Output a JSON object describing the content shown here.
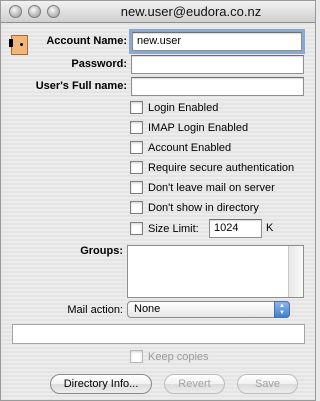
{
  "window": {
    "title": "new.user@eudora.co.nz"
  },
  "account": {
    "name_label": "Account Name:",
    "name_value": "new.user",
    "password_label": "Password:",
    "password_value": "",
    "fullname_label": "User's Full name:",
    "fullname_value": ""
  },
  "options": [
    {
      "label": "Login Enabled",
      "checked": false
    },
    {
      "label": "IMAP Login Enabled",
      "checked": false
    },
    {
      "label": "Account Enabled",
      "checked": false
    },
    {
      "label": "Require secure authentication",
      "checked": false
    },
    {
      "label": "Don't leave mail on server",
      "checked": false
    },
    {
      "label": "Don't show in directory",
      "checked": false
    }
  ],
  "size_limit": {
    "label": "Size Limit:",
    "value": "1024",
    "unit": "K"
  },
  "groups": {
    "label": "Groups:"
  },
  "mail_action": {
    "label": "Mail action:",
    "selected": "None"
  },
  "keep_copies": {
    "label": "Keep copies",
    "enabled": false
  },
  "buttons": {
    "directory_info": "Directory Info...",
    "revert": "Revert",
    "save": "Save"
  },
  "icons": {
    "close": "close-button-icon",
    "minimize": "minimize-button-icon",
    "zoom": "zoom-button-icon",
    "user": "user-face-icon"
  }
}
